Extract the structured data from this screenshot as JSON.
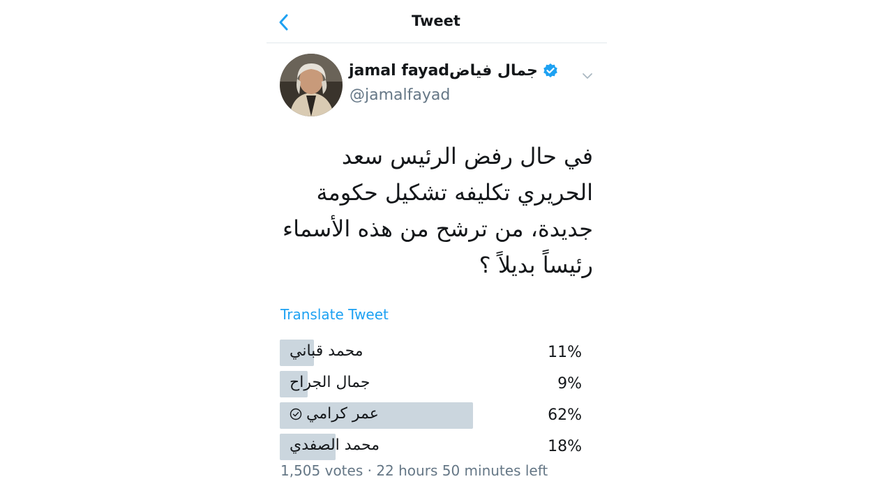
{
  "header": {
    "title": "Tweet"
  },
  "tweet": {
    "display_name": "jamal fayadجمال فياض",
    "handle": "@jamalfayad",
    "text_lines": [
      "في حال رفض الرئيس سعد",
      "الحريري تكليفه تشكيل حكومة",
      "جديدة، من ترشح من هذه الأسماء",
      "رئيساً بديلاً ؟"
    ],
    "translate_label": "Translate Tweet"
  },
  "poll": {
    "options": [
      {
        "label": "محمد قباني",
        "percent_text": "11%",
        "percent": 11,
        "selected": false
      },
      {
        "label": "جمال الجراح",
        "percent_text": "9%",
        "percent": 9,
        "selected": false
      },
      {
        "label": "عمر كرامي",
        "percent_text": "62%",
        "percent": 62,
        "selected": true
      },
      {
        "label": "محمد الصفدي",
        "percent_text": "18%",
        "percent": 18,
        "selected": false
      }
    ],
    "meta": "1,505 votes · 22 hours 50 minutes left"
  },
  "colors": {
    "accent": "#1da1f2",
    "verified": "#1da1f2",
    "poll_bar": "#cbd6de",
    "muted_text": "#657786"
  },
  "icons": {
    "back": "chevron-left-icon",
    "verified": "verified-badge-icon",
    "menu": "chevron-down-icon",
    "selected": "check-circle-icon"
  }
}
